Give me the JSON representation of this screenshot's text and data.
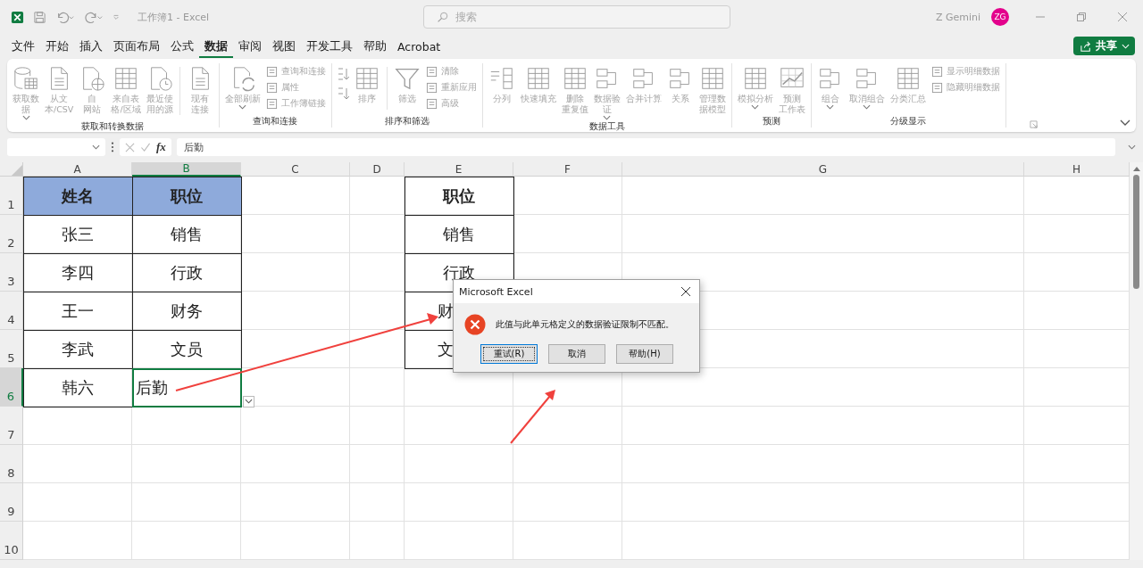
{
  "window": {
    "title": "工作簿1 - Excel",
    "search_placeholder": "搜索",
    "user_name": "Z Gemini",
    "user_initials": "ZG"
  },
  "menu": {
    "tabs": [
      {
        "label": "文件",
        "selected": false
      },
      {
        "label": "开始",
        "selected": false
      },
      {
        "label": "插入",
        "selected": false
      },
      {
        "label": "页面布局",
        "selected": false
      },
      {
        "label": "公式",
        "selected": false
      },
      {
        "label": "数据",
        "selected": true
      },
      {
        "label": "审阅",
        "selected": false
      },
      {
        "label": "视图",
        "selected": false
      },
      {
        "label": "开发工具",
        "selected": false
      },
      {
        "label": "帮助",
        "selected": false
      },
      {
        "label": "Acrobat",
        "selected": false
      }
    ],
    "share": "共享"
  },
  "ribbon": {
    "disabled": true,
    "groups": [
      {
        "label": "获取和转换数据",
        "items": [
          {
            "kind": "large",
            "lines": [
              "获取数",
              "据"
            ],
            "dropdown": true
          },
          {
            "kind": "large",
            "lines": [
              "从文",
              "本/CSV"
            ],
            "dropdown": false
          },
          {
            "kind": "large",
            "lines": [
              "自",
              "网站"
            ],
            "dropdown": false
          },
          {
            "kind": "large",
            "lines": [
              "来自表",
              "格/区域"
            ],
            "dropdown": false
          },
          {
            "kind": "large",
            "lines": [
              "最近使",
              "用的源"
            ],
            "dropdown": false
          },
          {
            "kind": "separator"
          },
          {
            "kind": "large",
            "lines": [
              "现有",
              "连接"
            ],
            "dropdown": false
          }
        ]
      },
      {
        "label": "查询和连接",
        "items": [
          {
            "kind": "large",
            "lines": [
              "全部刷新"
            ],
            "dropdown": true
          },
          {
            "kind": "stack",
            "entries": [
              {
                "label": "查询和连接"
              },
              {
                "label": "属性"
              },
              {
                "label": "工作簿链接"
              }
            ]
          }
        ]
      },
      {
        "label": "排序和筛选",
        "items": [
          {
            "kind": "sort-pair"
          },
          {
            "kind": "large",
            "lines": [
              "排序"
            ],
            "dropdown": false
          },
          {
            "kind": "separator"
          },
          {
            "kind": "large",
            "lines": [
              "筛选"
            ],
            "dropdown": false
          },
          {
            "kind": "stack",
            "entries": [
              {
                "label": "清除"
              },
              {
                "label": "重新应用"
              },
              {
                "label": "高级"
              }
            ]
          }
        ]
      },
      {
        "label": "数据工具",
        "items": [
          {
            "kind": "large",
            "lines": [
              "分列"
            ],
            "dropdown": false
          },
          {
            "kind": "large",
            "lines": [
              "快速填充"
            ],
            "dropdown": false
          },
          {
            "kind": "large",
            "lines": [
              "删除",
              "重复值"
            ],
            "dropdown": false
          },
          {
            "kind": "large",
            "lines": [
              "数据验",
              "证"
            ],
            "dropdown": true
          },
          {
            "kind": "large",
            "lines": [
              "合并计算"
            ],
            "dropdown": false
          },
          {
            "kind": "large",
            "lines": [
              "关系"
            ],
            "dropdown": false
          },
          {
            "kind": "large",
            "lines": [
              "管理数",
              "据模型"
            ],
            "dropdown": false
          }
        ]
      },
      {
        "label": "预测",
        "items": [
          {
            "kind": "large",
            "lines": [
              "模拟分析"
            ],
            "dropdown": true
          },
          {
            "kind": "large",
            "lines": [
              "预测",
              "工作表"
            ],
            "dropdown": false
          }
        ]
      },
      {
        "label": "分级显示",
        "items": [
          {
            "kind": "large",
            "lines": [
              "组合"
            ],
            "dropdown": true
          },
          {
            "kind": "large",
            "lines": [
              "取消组合"
            ],
            "dropdown": true
          },
          {
            "kind": "large",
            "lines": [
              "分类汇总"
            ],
            "dropdown": false
          },
          {
            "kind": "stack",
            "entries": [
              {
                "label": "显示明细数据"
              },
              {
                "label": "隐藏明细数据"
              }
            ]
          }
        ]
      }
    ]
  },
  "formula_bar": {
    "function_label": "fx",
    "value": "后勤"
  },
  "sheet": {
    "columns": [
      {
        "label": "A",
        "selected": false
      },
      {
        "label": "B",
        "selected": true
      },
      {
        "label": "C",
        "selected": false
      },
      {
        "label": "D",
        "selected": false
      },
      {
        "label": "E",
        "selected": false
      },
      {
        "label": "F",
        "selected": false
      },
      {
        "label": "G",
        "selected": false
      },
      {
        "label": "H",
        "selected": false
      }
    ],
    "rows": [
      {
        "label": "1",
        "selected": false,
        "cells": [
          {
            "kind": "header",
            "text": "姓名",
            "selected": false
          },
          {
            "kind": "header",
            "text": "职位",
            "selected": false
          },
          null,
          null,
          {
            "kind": "bold",
            "text": "职位",
            "selected": false
          }
        ]
      },
      {
        "label": "2",
        "selected": false,
        "cells": [
          {
            "kind": "table",
            "text": "张三",
            "selected": false
          },
          {
            "kind": "table",
            "text": "销售",
            "selected": false
          },
          null,
          null,
          {
            "kind": "table",
            "text": "销售",
            "selected": false
          }
        ]
      },
      {
        "label": "3",
        "selected": false,
        "cells": [
          {
            "kind": "table",
            "text": "李四",
            "selected": false
          },
          {
            "kind": "table",
            "text": "行政",
            "selected": false
          },
          null,
          null,
          {
            "kind": "table",
            "text": "行政",
            "selected": false
          }
        ]
      },
      {
        "label": "4",
        "selected": false,
        "cells": [
          {
            "kind": "table",
            "text": "王一",
            "selected": false
          },
          {
            "kind": "table",
            "text": "财务",
            "selected": false
          },
          null,
          null,
          {
            "kind": "covered",
            "text": "财",
            "selected": false
          }
        ]
      },
      {
        "label": "5",
        "selected": false,
        "cells": [
          {
            "kind": "table",
            "text": "李武",
            "selected": false
          },
          {
            "kind": "table",
            "text": "文员",
            "selected": false
          },
          null,
          null,
          {
            "kind": "covered",
            "text": "文",
            "selected": false
          }
        ]
      },
      {
        "label": "6",
        "selected": true,
        "cells": [
          {
            "kind": "table",
            "text": "韩六",
            "selected": false
          },
          {
            "kind": "table",
            "text": "后勤",
            "selected": true
          }
        ]
      },
      {
        "label": "7",
        "selected": false
      },
      {
        "label": "8",
        "selected": false
      },
      {
        "label": "9",
        "selected": false
      },
      {
        "label": "10",
        "selected": false
      }
    ]
  },
  "dialog": {
    "title": "Microsoft Excel",
    "message": "此值与此单元格定义的数据验证限制不匹配。",
    "buttons": [
      {
        "label": "重试(R)",
        "selected": true
      },
      {
        "label": "取消",
        "selected": false
      },
      {
        "label": "帮助(H)",
        "selected": false
      }
    ]
  }
}
